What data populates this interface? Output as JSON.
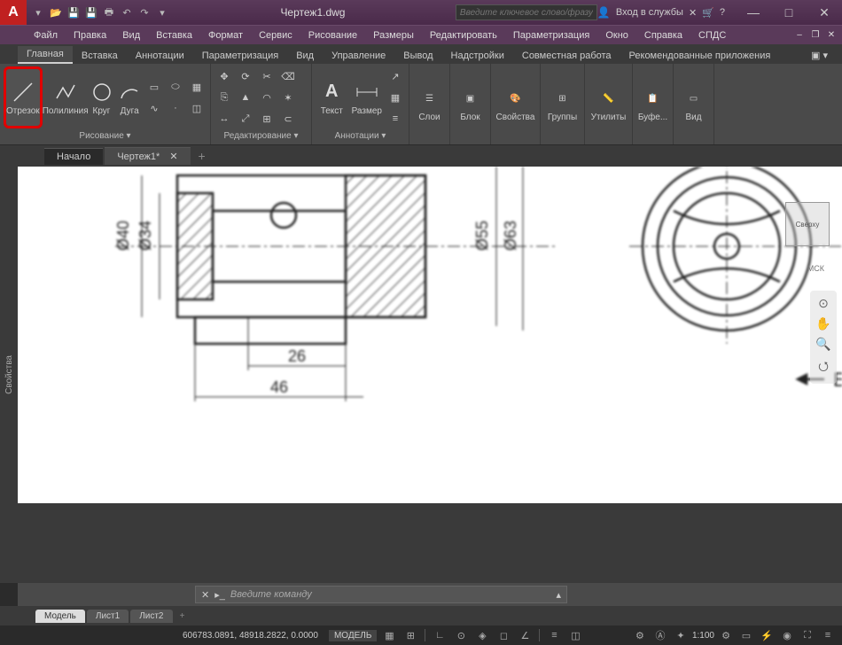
{
  "window": {
    "title": "Чертеж1.dwg",
    "search_placeholder": "Введите ключевое слово/фразу",
    "signin": "Вход в службы"
  },
  "menubar": [
    "Файл",
    "Правка",
    "Вид",
    "Вставка",
    "Формат",
    "Сервис",
    "Рисование",
    "Размеры",
    "Редактировать",
    "Параметризация",
    "Окно",
    "Справка",
    "СПДС"
  ],
  "ribbon_tabs": [
    "Главная",
    "Вставка",
    "Аннотации",
    "Параметризация",
    "Вид",
    "Управление",
    "Вывод",
    "Надстройки",
    "Совместная работа",
    "Рекомендованные приложения"
  ],
  "ribbon": {
    "draw": {
      "label": "Рисование ▾",
      "line": "Отрезок",
      "polyline": "Полилиния",
      "circle": "Круг",
      "arc": "Дуга"
    },
    "modify": {
      "label": "Редактирование ▾"
    },
    "annotation": {
      "label": "Аннотации ▾",
      "text": "Текст",
      "dimension": "Размер"
    },
    "layers": {
      "label": "Слои"
    },
    "block": {
      "label": "Блок"
    },
    "properties": {
      "label": "Свойства"
    },
    "groups": {
      "label": "Группы"
    },
    "utilities": {
      "label": "Утилиты"
    },
    "clipboard": {
      "label": "Буфе..."
    },
    "view": {
      "label": "Вид"
    }
  },
  "filetabs": {
    "start": "Начало",
    "active": "Чертеж1*"
  },
  "drawing_dims": {
    "d1": "Ø40",
    "d2": "Ø34",
    "d3": "Ø55",
    "d4": "Ø63",
    "w1": "26",
    "w2": "46",
    "section": "Б"
  },
  "viewcube": {
    "top": "Сверху",
    "wcs": "МСК"
  },
  "sidebar_label": "Свойства",
  "command": {
    "placeholder": "Введите команду"
  },
  "modeltabs": [
    "Модель",
    "Лист1",
    "Лист2"
  ],
  "status": {
    "coords": "606783.0891, 48918.2822, 0.0000",
    "space": "МОДЕЛЬ",
    "scale": "1:100"
  }
}
